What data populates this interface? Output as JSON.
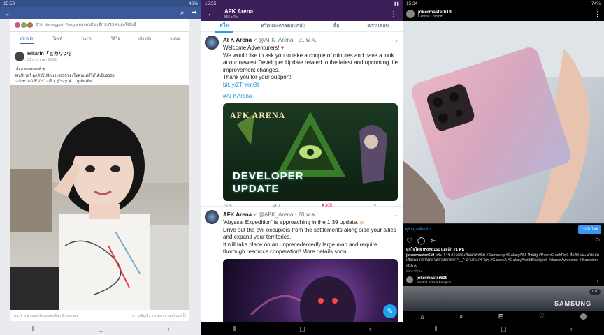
{
  "facebook": {
    "status_time": "15:50",
    "battery": "48%",
    "friends_text": "ข้าง, Narongpolt, Pradya และคนอื่นๆ อีก 8,713 คนถูกใจสิ่งนี้",
    "tabs": [
      "หน้าหลัก",
      "โพสต์",
      "รูปภาพ",
      "วิดีโอ",
      "เกี่ยวกับ",
      "ชุมชน"
    ],
    "post": {
      "author": "Hikarin「ヒカリン」",
      "time": "31 พ.ค. เวลา 19:22",
      "line1": "เสื้อสายเต่ยอนทั่วๆ",
      "line2": "คุณฟิเวอร์ ดูคลิปไปปัดแระ5555ของใหคนแต่ก็ไม่ได้เป็น5555",
      "line3": "t−シャツのデザイン良すぎ〜ます… ดูเพิ่มเติม",
      "reactions": "ศน, ข้าง สาวสุดหรือ และคนอื่นๆ อีก 230 คน",
      "comments": "ความคิดเห็น 6 รายการ · แชร์ 11 ครั้ง"
    }
  },
  "twitter": {
    "status_time": "15:55",
    "account_name": "AFK Arena",
    "account_sub": "555 ทวีต",
    "tabs": [
      "ทวีต",
      "ทวีตและการตอบกลับ",
      "สื่อ",
      "ความชอบ"
    ],
    "tweets": [
      {
        "name": "AFK Arena",
        "handle": "@AFK_Arena · 21 พ.ค.",
        "lines": [
          "Welcome Adventurers!",
          "We would like to ask you to take a couple of minutes and have a look at our newest Developer Update related to the latest and upcoming life improvement changes.",
          "Thank you for your support!"
        ],
        "link": "bit.ly/2TrwmGt",
        "hashtag": "#AFKArena",
        "image_logo": "AFK ARENA",
        "image_title1": "DEVELOPER",
        "image_title2": "UPDATE",
        "replies": "9",
        "retweets": "7",
        "likes": "305"
      },
      {
        "name": "AFK Arena",
        "handle": "@AFK_Arena · 20 พ.ค.",
        "lines": [
          "'Abyssal Expedition' is approaching in the 1.39 update.",
          "Drive out the evil occupiers from the settlements along side your allies and expand your territories.",
          "It will take place on an unprecedentedly large map and require thorough resource cooperation! More details soon!"
        ]
      }
    ]
  },
  "instagram": {
    "status_time": "15:34",
    "battery": "74%",
    "user": "jokermaster619",
    "location": "Central Chidlom",
    "more_info": "ดูข้อมูลเพิ่มเติม",
    "cta": "ไปเว็บไซต์",
    "likes": "ถูกใจโดย thong151 และอีก 71 คน",
    "caption_user": "jokermaster619",
    "caption": "พระเจ้าร สายเลดเห็นมาตุหนับ #Samsung #GalaxyA51 สีชมพู #PrismCrushPink ที่ผลิตแนะนาย สดเลือเพลงใสไปดยโหลใหลกตลก^__^ นำเก็บเกรามๆ #GalaxyA #GalaxyAwithBlackpink #danceAwesome #Blackpink #Blink",
    "age": "23 นาทีก่อน",
    "user2": "jokermaster619",
    "location2": "Waldorf Astoria Bangkok",
    "counter": "1/10",
    "brand_text": "SAMSUNG"
  },
  "colors": {
    "fb_blue": "#3b5998",
    "tw_purple": "#3b1f58",
    "tw_blue": "#1da1f2",
    "ig_blue": "#3897f0"
  }
}
